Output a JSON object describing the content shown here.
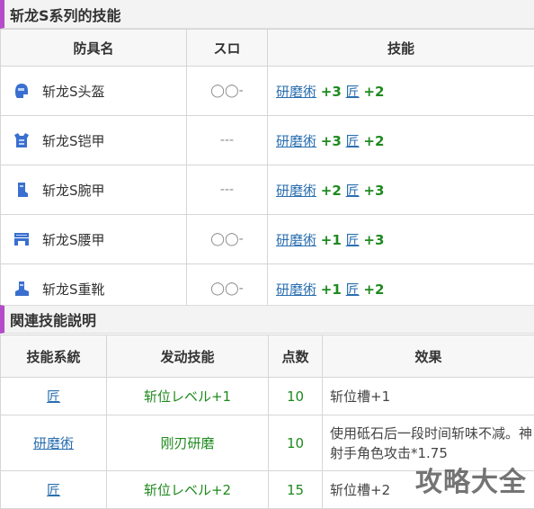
{
  "section1": {
    "title": "斩龙S系列的技能"
  },
  "armor_table": {
    "headers": [
      "防具名",
      "スロ",
      "技能"
    ],
    "rows": [
      {
        "name": "斩龙S头盔",
        "icon": "helmet-icon",
        "slot": "◯◯-",
        "skill1": "研磨術",
        "val1": "+3",
        "skill2": "匠",
        "val2": "+2"
      },
      {
        "name": "斩龙S铠甲",
        "icon": "chest-armor-icon",
        "slot": "---",
        "skill1": "研磨術",
        "val1": "+3",
        "skill2": "匠",
        "val2": "+2"
      },
      {
        "name": "斩龙S腕甲",
        "icon": "arm-guard-icon",
        "slot": "---",
        "skill1": "研磨術",
        "val1": "+2",
        "skill2": "匠",
        "val2": "+3"
      },
      {
        "name": "斩龙S腰甲",
        "icon": "waist-armor-icon",
        "slot": "◯◯-",
        "skill1": "研磨術",
        "val1": "+1",
        "skill2": "匠",
        "val2": "+3"
      },
      {
        "name": "斩龙S重靴",
        "icon": "boots-icon",
        "slot": "◯◯-",
        "skill1": "研磨術",
        "val1": "+1",
        "skill2": "匠",
        "val2": "+2"
      }
    ]
  },
  "section2": {
    "title": "関連技能説明"
  },
  "skill_table": {
    "headers": [
      "技能系統",
      "发动技能",
      "点数",
      "效果"
    ],
    "rows": [
      {
        "system": "匠",
        "active": "斩位レベル+1",
        "points": "10",
        "effect": "斩位槽+1"
      },
      {
        "system": "研磨術",
        "active": "刚刃研磨",
        "points": "10",
        "effect": "使用砥石后一段时间斩味不减。神射手角色攻击*1.75"
      },
      {
        "system": "匠",
        "active": "斩位レベル+2",
        "points": "15",
        "effect": "斩位槽+2"
      }
    ]
  },
  "watermark": "攻略大全",
  "colors": {
    "accent": "#b44bc8",
    "link": "#2a6fb0",
    "positive": "#1e8a1e",
    "icon": "#3a6fd0"
  }
}
